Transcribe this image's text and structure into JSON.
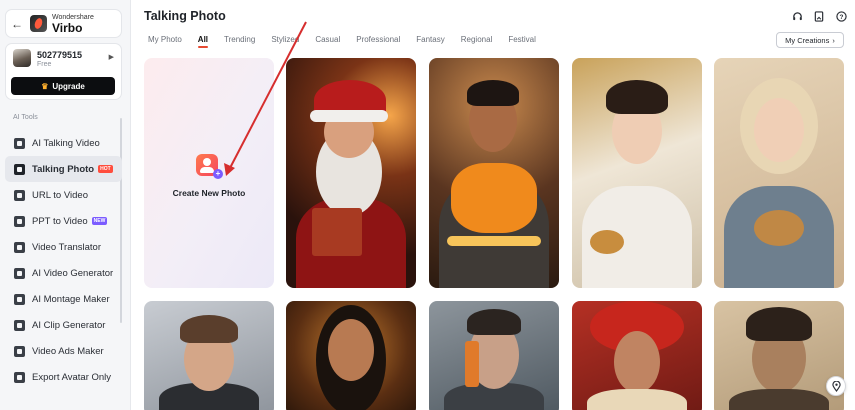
{
  "brand": {
    "sub": "Wondershare",
    "name": "Virbo"
  },
  "account": {
    "user_id": "502779515",
    "plan": "Free",
    "upgrade_label": "Upgrade"
  },
  "sidebar": {
    "section_label": "AI Tools",
    "items": [
      {
        "label": "AI Talking Video",
        "icon": "talking-video-icon"
      },
      {
        "label": "Talking Photo",
        "icon": "talking-photo-icon",
        "badge": "HOT",
        "active": true
      },
      {
        "label": "URL to Video",
        "icon": "url-icon"
      },
      {
        "label": "PPT to Video",
        "icon": "ppt-icon",
        "badge": "NEW"
      },
      {
        "label": "Video Translator",
        "icon": "translator-icon"
      },
      {
        "label": "AI Video Generator",
        "icon": "video-generator-icon"
      },
      {
        "label": "AI Montage Maker",
        "icon": "montage-icon"
      },
      {
        "label": "AI Clip Generator",
        "icon": "clip-icon"
      },
      {
        "label": "Video Ads Maker",
        "icon": "ads-icon"
      },
      {
        "label": "Export Avatar Only",
        "icon": "export-icon"
      }
    ]
  },
  "header": {
    "title": "Talking Photo",
    "icons": [
      "headset-icon",
      "bookmark-icon",
      "help-icon"
    ]
  },
  "tabs": [
    {
      "label": "My Photo"
    },
    {
      "label": "All",
      "active": true
    },
    {
      "label": "Trending"
    },
    {
      "label": "Stylized"
    },
    {
      "label": "Casual"
    },
    {
      "label": "Professional"
    },
    {
      "label": "Fantasy"
    },
    {
      "label": "Regional"
    },
    {
      "label": "Festival"
    }
  ],
  "my_creations_label": "My Creations",
  "create_card": {
    "label": "Create New Photo"
  },
  "colors": {
    "accent": "#e64a32",
    "arrow": "#d62e2e",
    "new_badge": "#7b5cff"
  }
}
